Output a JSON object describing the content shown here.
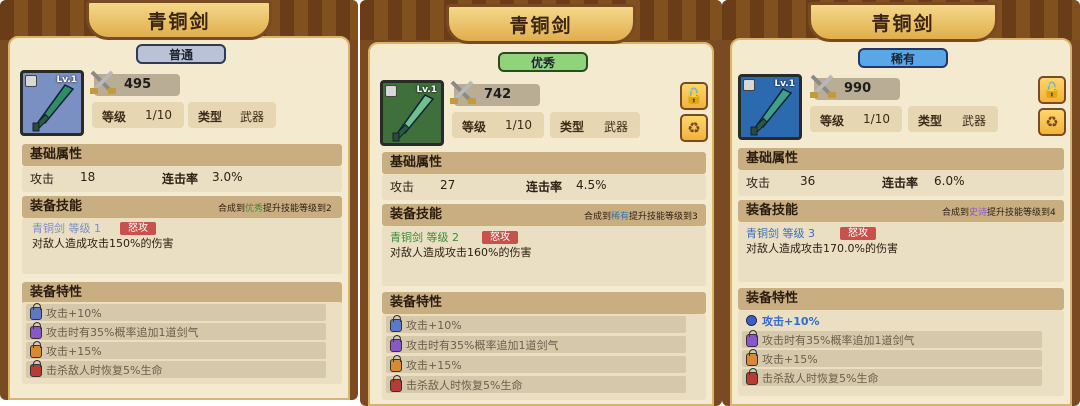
{
  "colors": {
    "common": "#b9c2d6",
    "excellent": "#8fd47a",
    "rare": "#5aa7e8",
    "icon_blue": "#7a8fc2",
    "icon_green": "#3f6f3a",
    "icon_rare": "#2c6ab0",
    "skill_green": "#3c8a3a",
    "skill_blue": "#3a6fb8",
    "trait_blue": "#2f6bd0",
    "lock_blue": "#5c79c8",
    "lock_purple": "#8a57c9",
    "lock_orange": "#d88a33",
    "lock_red": "#b83b36"
  },
  "cards": [
    {
      "title": "青铜剑",
      "rarity": "普通",
      "level_badge": "Lv.1",
      "power": "495",
      "level_label": "等级",
      "level_value": "1/10",
      "type_label": "类型",
      "type_value": "武器",
      "base_title": "基础属性",
      "attack_label": "攻击",
      "attack_value": "18",
      "combo_label": "连击率",
      "combo_value": "3.0%",
      "skill_title": "装备技能",
      "skill_hint_pre": "合成到",
      "skill_hint_grade": "优秀",
      "skill_hint_post": "提升技能等级到2",
      "skill_name": "青铜剑 等级 1",
      "skill_tag": "怒攻",
      "skill_desc": "对敌人造成攻击150%的伤害",
      "traits_title": "装备特性",
      "traits": [
        "攻击+10%",
        "攻击时有35%概率追加1道剑气",
        "攻击+15%",
        "击杀敌人时恢复5%生命"
      ]
    },
    {
      "title": "青铜剑",
      "rarity": "优秀",
      "level_badge": "Lv.1",
      "power": "742",
      "level_label": "等级",
      "level_value": "1/10",
      "type_label": "类型",
      "type_value": "武器",
      "base_title": "基础属性",
      "attack_label": "攻击",
      "attack_value": "27",
      "combo_label": "连击率",
      "combo_value": "4.5%",
      "skill_title": "装备技能",
      "skill_hint_pre": "合成到",
      "skill_hint_grade": "稀有",
      "skill_hint_post": "提升技能等级到3",
      "skill_name": "青铜剑 等级 2",
      "skill_tag": "怒攻",
      "skill_desc": "对敌人造成攻击160%的伤害",
      "traits_title": "装备特性",
      "traits": [
        "攻击+10%",
        "攻击时有35%概率追加1道剑气",
        "攻击+15%",
        "击杀敌人时恢复5%生命"
      ]
    },
    {
      "title": "青铜剑",
      "rarity": "稀有",
      "level_badge": "Lv.1",
      "power": "990",
      "level_label": "等级",
      "level_value": "1/10",
      "type_label": "类型",
      "type_value": "武器",
      "base_title": "基础属性",
      "attack_label": "攻击",
      "attack_value": "36",
      "combo_label": "连击率",
      "combo_value": "6.0%",
      "skill_title": "装备技能",
      "skill_hint_pre": "合成到",
      "skill_hint_grade": "史诗",
      "skill_hint_post": "提升技能等级到4",
      "skill_name": "青铜剑 等级 3",
      "skill_tag": "怒攻",
      "skill_desc": "对敌人造成攻击170.0%的伤害",
      "traits_title": "装备特性",
      "traits": [
        "攻击+10%",
        "攻击时有35%概率追加1道剑气",
        "攻击+15%",
        "击杀敌人时恢复5%生命"
      ]
    }
  ],
  "side_buttons": {
    "lock_icon": "unlock-icon",
    "recycle_icon": "recycle-icon"
  }
}
